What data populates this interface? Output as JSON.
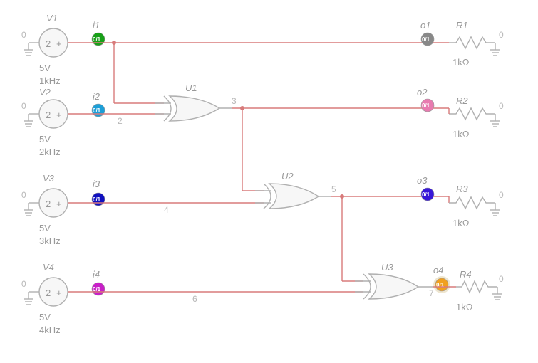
{
  "circuit": {
    "sources": [
      {
        "name": "V1",
        "voltage": "5V",
        "freq": "1kHz",
        "inner": "2"
      },
      {
        "name": "V2",
        "voltage": "5V",
        "freq": "2kHz",
        "inner": "2"
      },
      {
        "name": "V3",
        "voltage": "5V",
        "freq": "3kHz",
        "inner": "2"
      },
      {
        "name": "V4",
        "voltage": "5V",
        "freq": "4kHz",
        "inner": "2"
      }
    ],
    "gates": [
      {
        "name": "U1",
        "type": "XOR"
      },
      {
        "name": "U2",
        "type": "XOR"
      },
      {
        "name": "U3",
        "type": "XOR"
      }
    ],
    "resistors": [
      {
        "name": "R1",
        "value": "1kΩ"
      },
      {
        "name": "R2",
        "value": "1kΩ"
      },
      {
        "name": "R3",
        "value": "1kΩ"
      },
      {
        "name": "R4",
        "value": "1kΩ"
      }
    ],
    "probes_in": [
      {
        "name": "i1",
        "color": "#18a018",
        "text": "0/1"
      },
      {
        "name": "i2",
        "color": "#1c9fd8",
        "text": "0/1"
      },
      {
        "name": "i3",
        "color": "#1010c0",
        "text": "0/1"
      },
      {
        "name": "i4",
        "color": "#c820c8",
        "text": "0/1"
      }
    ],
    "probes_out": [
      {
        "name": "o1",
        "color": "#888888",
        "text": "0/1"
      },
      {
        "name": "o2",
        "color": "#e87bb0",
        "text": "0/1"
      },
      {
        "name": "o3",
        "color": "#3818d8",
        "text": "0/1"
      },
      {
        "name": "o4",
        "color": "#f0a020",
        "text": "0/1"
      }
    ],
    "nets": {
      "zero": "0",
      "n2": "2",
      "n3": "3",
      "n4": "4",
      "n5": "5",
      "n6": "6",
      "n7": "7"
    }
  }
}
